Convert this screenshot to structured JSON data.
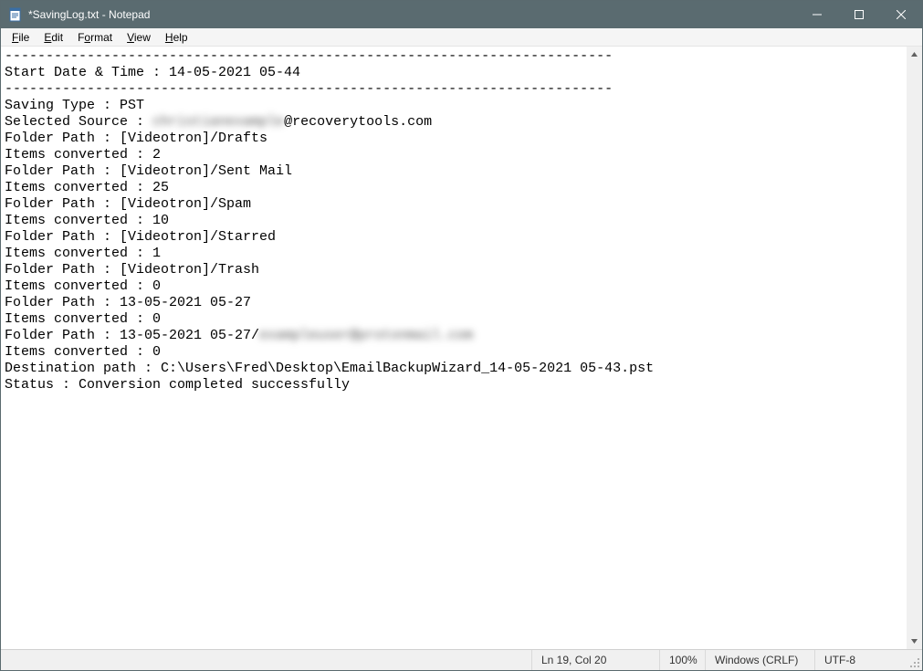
{
  "window": {
    "title": "*SavingLog.txt - Notepad"
  },
  "menu": {
    "file": "File",
    "edit": "Edit",
    "format": "Format",
    "view": "View",
    "help": "Help"
  },
  "content": {
    "sep1": "--------------------------------------------------------------------------",
    "start_line": "Start Date & Time : 14-05-2021 05-44",
    "sep2": "--------------------------------------------------------------------------",
    "saving_type": "Saving Type : PST",
    "selected_source_prefix": "Selected Source : ",
    "selected_source_obscured": "christianexample",
    "selected_source_suffix": "@recoverytools.com",
    "l1": "Folder Path : [Videotron]/Drafts",
    "l2": "Items converted : 2",
    "l3": "Folder Path : [Videotron]/Sent Mail",
    "l4": "Items converted : 25",
    "l5": "Folder Path : [Videotron]/Spam",
    "l6": "Items converted : 10",
    "l7": "Folder Path : [Videotron]/Starred",
    "l8": "Items converted : 1",
    "l9": "Folder Path : [Videotron]/Trash",
    "l10": "Items converted : 0",
    "l11": "Folder Path : 13-05-2021 05-27",
    "l12": "Items converted : 0",
    "l13_prefix": "Folder Path : 13-05-2021 05-27/",
    "l13_obscured": "exampleuser@protonmail.com",
    "l14": "Items converted : 0",
    "dest": "Destination path : C:\\Users\\Fred\\Desktop\\EmailBackupWizard_14-05-2021 05-43.pst",
    "status": "Status : Conversion completed successfully"
  },
  "statusbar": {
    "position": "Ln 19, Col 20",
    "zoom": "100%",
    "eol": "Windows (CRLF)",
    "encoding": "UTF-8"
  }
}
